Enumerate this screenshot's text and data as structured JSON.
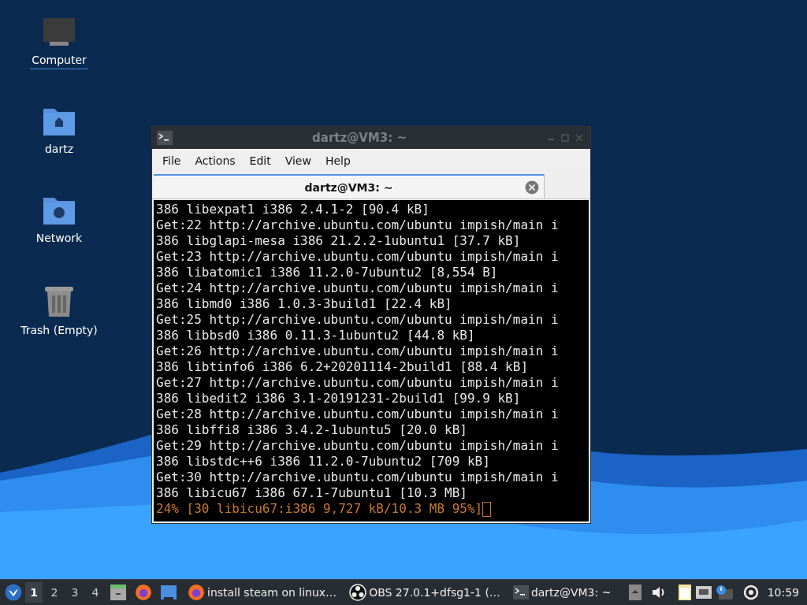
{
  "desktop_icons": [
    {
      "kind": "computer",
      "label": "Computer",
      "selected": true
    },
    {
      "kind": "home",
      "label": "dartz",
      "selected": false
    },
    {
      "kind": "network",
      "label": "Network",
      "selected": false
    },
    {
      "kind": "trash",
      "label": "Trash (Empty)",
      "selected": false
    }
  ],
  "window": {
    "title": "dartz@VM3: ~",
    "menu": [
      "File",
      "Actions",
      "Edit",
      "View",
      "Help"
    ],
    "tab": {
      "title": "dartz@VM3: ~"
    },
    "lines": [
      {
        "kind": "output",
        "text": "386 libexpat1 i386 2.4.1-2 [90.4 kB]"
      },
      {
        "kind": "output",
        "text": "Get:22 http://archive.ubuntu.com/ubuntu impish/main i"
      },
      {
        "kind": "output",
        "text": "386 libglapi-mesa i386 21.2.2-1ubuntu1 [37.7 kB]"
      },
      {
        "kind": "output",
        "text": "Get:23 http://archive.ubuntu.com/ubuntu impish/main i"
      },
      {
        "kind": "output",
        "text": "386 libatomic1 i386 11.2.0-7ubuntu2 [8,554 B]"
      },
      {
        "kind": "output",
        "text": "Get:24 http://archive.ubuntu.com/ubuntu impish/main i"
      },
      {
        "kind": "output",
        "text": "386 libmd0 i386 1.0.3-3build1 [22.4 kB]"
      },
      {
        "kind": "output",
        "text": "Get:25 http://archive.ubuntu.com/ubuntu impish/main i"
      },
      {
        "kind": "output",
        "text": "386 libbsd0 i386 0.11.3-1ubuntu2 [44.8 kB]"
      },
      {
        "kind": "output",
        "text": "Get:26 http://archive.ubuntu.com/ubuntu impish/main i"
      },
      {
        "kind": "output",
        "text": "386 libtinfo6 i386 6.2+20201114-2build1 [88.4 kB]"
      },
      {
        "kind": "output",
        "text": "Get:27 http://archive.ubuntu.com/ubuntu impish/main i"
      },
      {
        "kind": "output",
        "text": "386 libedit2 i386 3.1-20191231-2build1 [99.9 kB]"
      },
      {
        "kind": "output",
        "text": "Get:28 http://archive.ubuntu.com/ubuntu impish/main i"
      },
      {
        "kind": "output",
        "text": "386 libffi8 i386 3.4.2-1ubuntu5 [20.0 kB]"
      },
      {
        "kind": "output",
        "text": "Get:29 http://archive.ubuntu.com/ubuntu impish/main i"
      },
      {
        "kind": "output",
        "text": "386 libstdc++6 i386 11.2.0-7ubuntu2 [709 kB]"
      },
      {
        "kind": "output",
        "text": "Get:30 http://archive.ubuntu.com/ubuntu impish/main i"
      },
      {
        "kind": "output",
        "text": "386 libicu67 i386 67.1-7ubuntu1 [10.3 MB]"
      },
      {
        "kind": "progress",
        "text": "24% [30 libicu67:i386 9,727 kB/10.3 MB 95%]"
      }
    ]
  },
  "taskbar": {
    "workspaces": [
      {
        "label": "1",
        "selected": true
      },
      {
        "label": "2",
        "selected": false
      },
      {
        "label": "3",
        "selected": false
      },
      {
        "label": "4",
        "selected": false
      }
    ],
    "launchers": [
      {
        "kind": "files"
      },
      {
        "kind": "firefox"
      },
      {
        "kind": "desktop"
      }
    ],
    "windows": [
      {
        "kind": "firefox",
        "label": "install steam on linux…"
      },
      {
        "kind": "obs",
        "label": "OBS 27.0.1+dfsg1-1 (…"
      },
      {
        "kind": "terminal",
        "label": "dartz@VM3: ~"
      }
    ],
    "clock": "10:59"
  }
}
